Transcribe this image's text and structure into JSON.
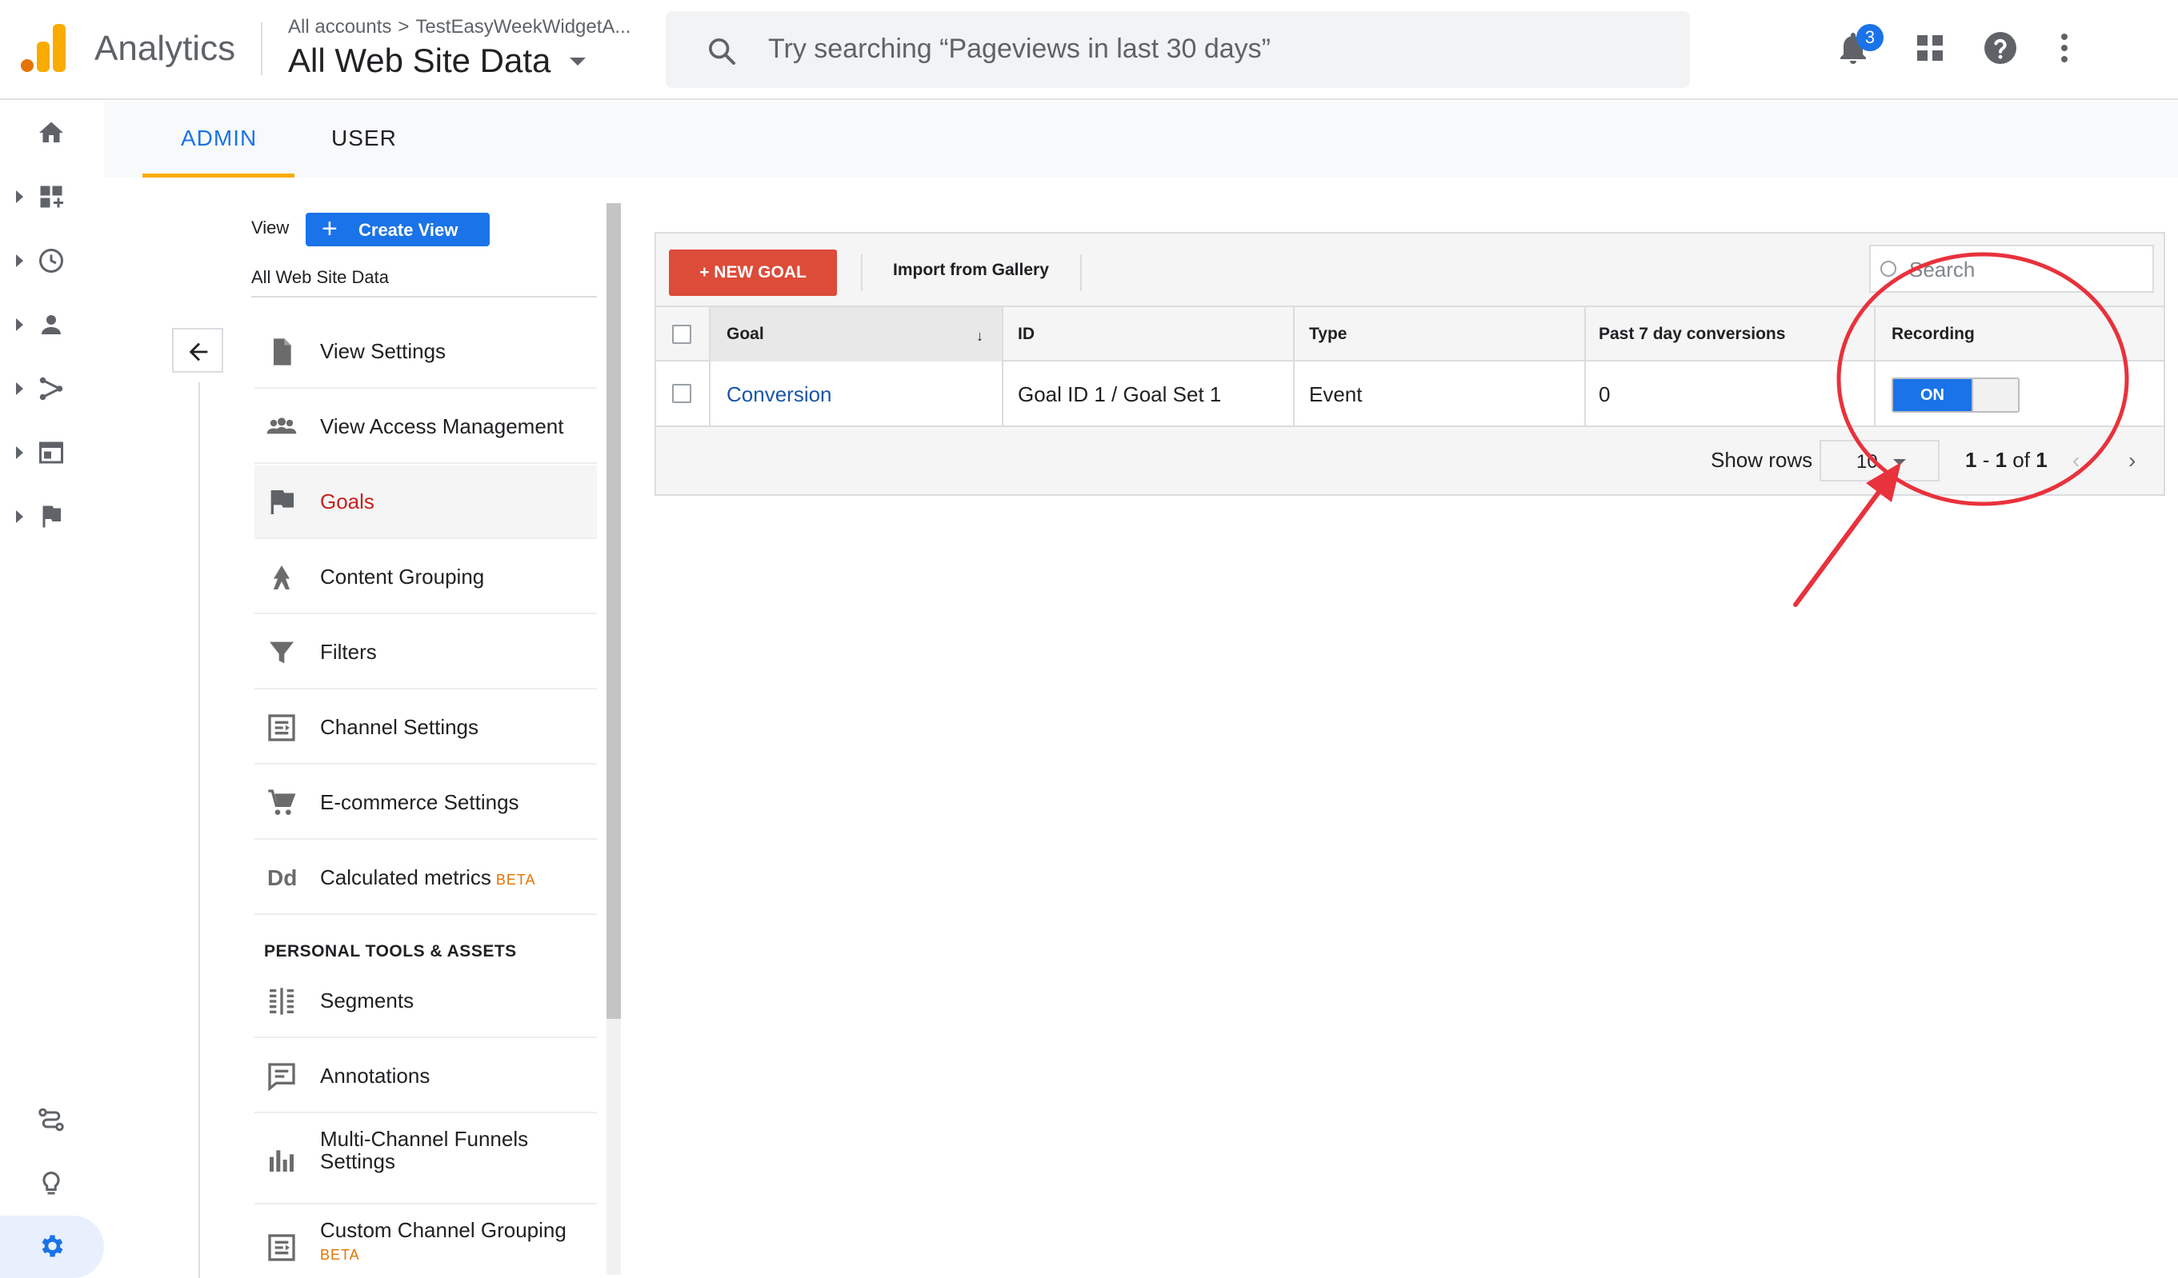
{
  "header": {
    "app_name": "Analytics",
    "breadcrumb": [
      "All accounts",
      "TestEasyWeekWidgetA..."
    ],
    "breadcrumb_sep": ">",
    "view_title": "All Web Site Data",
    "search_placeholder": "Try searching “Pageviews in last 30 days”",
    "notification_count": "3",
    "icons": [
      "search-icon",
      "bell-icon",
      "apps-grid-icon",
      "help-icon",
      "more-vert-icon"
    ]
  },
  "rail": {
    "items": [
      "home-icon",
      "dashboard-icon",
      "clock-icon",
      "person-icon",
      "acquisition-icon",
      "behavior-icon",
      "flag-icon"
    ],
    "bottom_items": [
      "attribution-icon",
      "lightbulb-icon",
      "gear-icon"
    ]
  },
  "tabs": [
    {
      "label": "ADMIN",
      "active": true
    },
    {
      "label": "USER",
      "active": false
    }
  ],
  "view_panel": {
    "label": "View",
    "create_button": "Create View",
    "create_plus": "+",
    "selected_view": "All Web Site Data",
    "menu": [
      {
        "label": "View Settings",
        "icon": "document-icon",
        "active": false
      },
      {
        "label": "View Access Management",
        "icon": "people-icon",
        "active": false
      },
      {
        "label": "Goals",
        "icon": "flag-icon",
        "active": true
      },
      {
        "label": "Content Grouping",
        "icon": "walking-icon",
        "active": false
      },
      {
        "label": "Filters",
        "icon": "filter-icon",
        "active": false
      },
      {
        "label": "Channel Settings",
        "icon": "channel-icon",
        "active": false
      },
      {
        "label": "E-commerce Settings",
        "icon": "cart-icon",
        "active": false
      },
      {
        "label": "Calculated metrics",
        "badge": "BETA",
        "icon": "dd-icon",
        "active": false
      }
    ],
    "section_header": "PERSONAL TOOLS & ASSETS",
    "tools": [
      {
        "label": "Segments",
        "icon": "segments-icon"
      },
      {
        "label": "Annotations",
        "icon": "annotation-icon"
      },
      {
        "label_lines": [
          "Multi-Channel Funnels",
          "Settings"
        ],
        "icon": "bar-chart-icon"
      },
      {
        "label": "Custom Channel Grouping",
        "badge": "BETA",
        "icon": "channel-icon"
      }
    ],
    "dd_text": "Dd"
  },
  "goals_table": {
    "new_goal_button": "+ NEW GOAL",
    "import_link": "Import from Gallery",
    "search_placeholder": "Search",
    "columns": [
      "Goal",
      "ID",
      "Type",
      "Past 7 day conversions",
      "Recording"
    ],
    "sort_indicator": "↓",
    "rows": [
      {
        "goal": "Conversion",
        "id": "Goal ID 1 / Goal Set 1",
        "type": "Event",
        "conversions": "0",
        "recording": "ON"
      }
    ],
    "pager": {
      "show_rows_label": "Show rows",
      "rows_value": "10",
      "range_start": "1",
      "range_dash": " - ",
      "range_end": "1",
      "range_of": " of ",
      "range_total": "1",
      "prev": "‹",
      "next": "›"
    }
  },
  "colors": {
    "accent": "#1a73e8",
    "tab_underline": "#f9ab00",
    "new_goal": "#dd4b39",
    "active_menu": "#c5221f",
    "annotation": "#e8323c"
  }
}
